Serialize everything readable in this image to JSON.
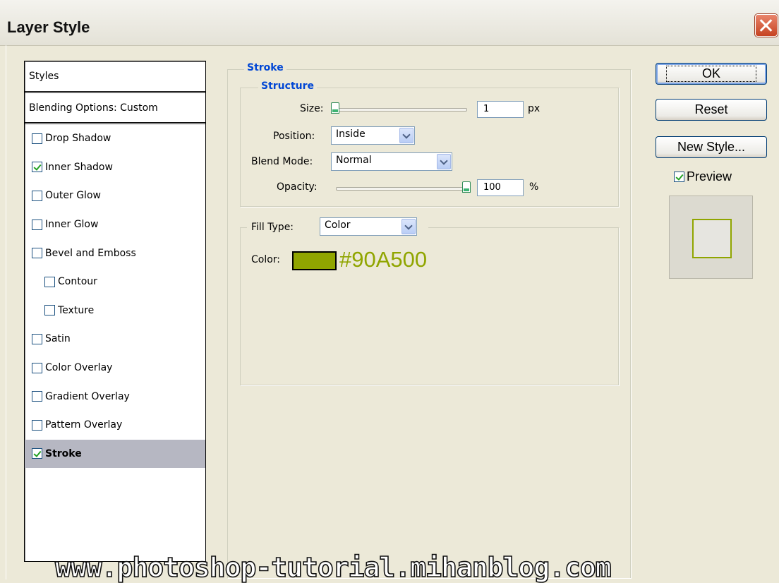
{
  "window": {
    "title": "Layer Style"
  },
  "styles_panel": {
    "header": "Styles",
    "blending": "Blending Options: Custom",
    "items": [
      {
        "label": "Drop Shadow",
        "checked": false
      },
      {
        "label": "Inner Shadow",
        "checked": true
      },
      {
        "label": "Outer Glow",
        "checked": false
      },
      {
        "label": "Inner Glow",
        "checked": false
      },
      {
        "label": "Bevel and Emboss",
        "checked": false
      },
      {
        "label": "Contour",
        "checked": false
      },
      {
        "label": "Texture",
        "checked": false
      },
      {
        "label": "Satin",
        "checked": false
      },
      {
        "label": "Color Overlay",
        "checked": false
      },
      {
        "label": "Gradient Overlay",
        "checked": false
      },
      {
        "label": "Pattern Overlay",
        "checked": false
      },
      {
        "label": "Stroke",
        "checked": true
      }
    ]
  },
  "stroke": {
    "group_title": "Stroke",
    "structure_title": "Structure",
    "size_label": "Size:",
    "size_value": "1",
    "size_unit": "px",
    "position_label": "Position:",
    "position_value": "Inside",
    "blend_label": "Blend Mode:",
    "blend_value": "Normal",
    "opacity_label": "Opacity:",
    "opacity_value": "100",
    "opacity_unit": "%",
    "fill_type_label": "Fill Type:",
    "fill_type_value": "Color",
    "color_label": "Color:",
    "color_hex": "#90A500"
  },
  "buttons": {
    "ok": "OK",
    "reset": "Reset",
    "new_style": "New Style...",
    "preview": "Preview",
    "preview_checked": true
  },
  "watermark": "www.photoshop-tutorial.mihanblog.com"
}
